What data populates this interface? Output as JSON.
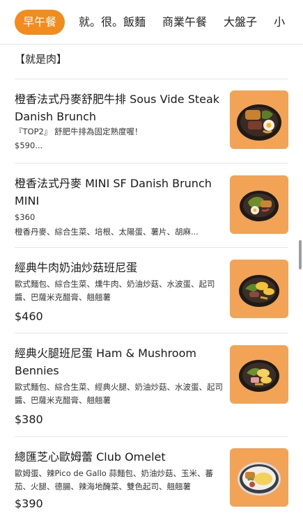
{
  "tabs": [
    {
      "label": "早午餐",
      "active": true
    },
    {
      "label": "就。很。飯麵"
    },
    {
      "label": "商業午餐"
    },
    {
      "label": "大盤子"
    },
    {
      "label": "小"
    }
  ],
  "section": {
    "title": "【就是肉】"
  },
  "items": [
    {
      "name": "橙香法式丹麥舒肥牛排 Sous Vide Steak Danish Brunch",
      "desc": "『TOP2』 舒肥牛排為固定熟度喔！",
      "price_inline": "$590...",
      "image": "steak-danish-brunch-photo"
    },
    {
      "name": "橙香法式丹麥 MINI SF Danish Brunch MINI",
      "price_inline": "$360",
      "desc": "橙香丹麥、綜合生菜、培根、太陽蛋、薯片、胡麻...",
      "image": "mini-danish-brunch-photo"
    },
    {
      "name": "經典牛肉奶油炒菇班尼蛋",
      "desc": "歐式麵包、綜合生菜、燻牛肉、奶油炒菇、水波蛋、起司醬、巴薩米克醋膏、翹翹薯",
      "price": "$460",
      "image": "beef-benedict-photo"
    },
    {
      "name": "經典火腿班尼蛋 Ham & Mushroom Bennies",
      "desc": "歐式麵包、綜合生菜、經典火腿、奶油炒菇、水波蛋、起司醬、巴薩米克醋膏、翹翹薯",
      "price": "$380",
      "image": "ham-bennies-photo"
    },
    {
      "name": "總匯芝心歐姆蕾 Club Omelet",
      "desc": "歐姆蛋、辣Pico de Gallo 蒜麵包、奶油炒菇、玉米、蕃茄、火腿、德腸、辣海地醃菜、雙色起司、翹翹薯",
      "price": "$390",
      "image": "club-omelet-photo"
    }
  ],
  "colors": {
    "accent": "#f28c1e",
    "photo_bg": "#f3a356",
    "text": "#1a1a1a",
    "divider": "#e6e6e6"
  }
}
